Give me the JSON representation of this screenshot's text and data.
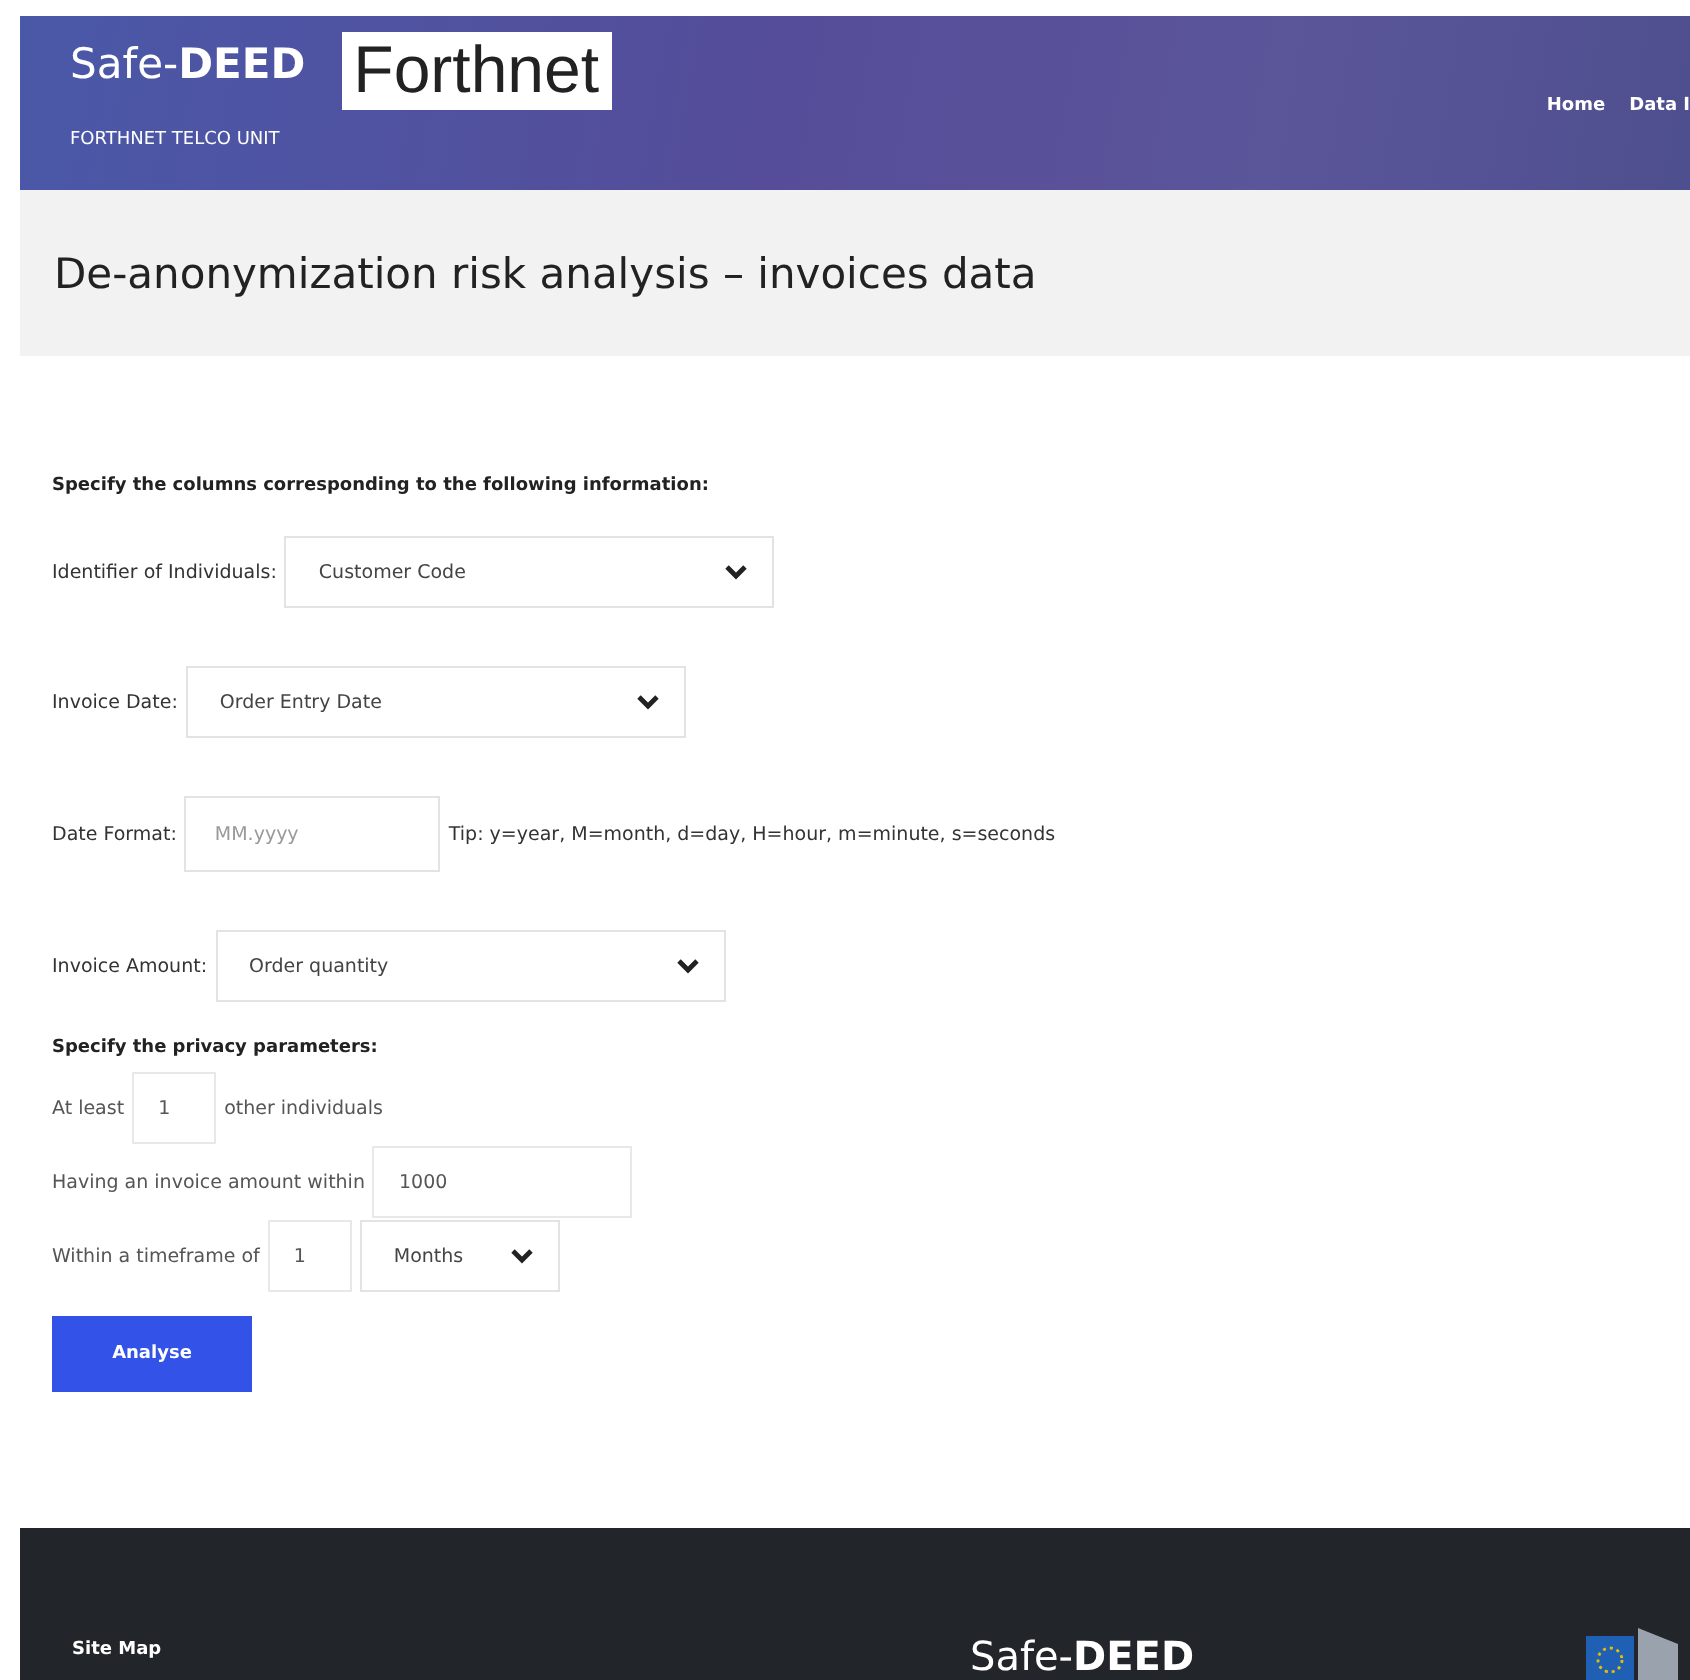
{
  "header": {
    "logo": "Safe-**DEED**",
    "brand": "Forthnet",
    "subtitle": "FORTHNET TELCO UNIT",
    "nav": [
      "Home",
      "Data I"
    ]
  },
  "page_title": "De-anonymization risk analysis – invoices data",
  "columns_heading": "Specify the columns corresponding to the following information:",
  "column_fields": [
    {
      "label": "Identifier of Individuals:",
      "kind": "select",
      "value": "Customer Code"
    },
    {
      "label": "Invoice Date:",
      "kind": "select",
      "value": "Order Entry Date"
    },
    {
      "label": "Date Format:",
      "kind": "input",
      "placeholder": "MM.yyyy",
      "tip": "Tip: y=year, M=month, d=day, H=hour, m=minute, s=seconds"
    },
    {
      "label": "Invoice Amount:",
      "kind": "select",
      "value": "Order quantity"
    }
  ],
  "privacy_heading": "Specify the privacy parameters:",
  "privacy": {
    "at_least_label": "At least",
    "at_least_value": "1",
    "at_least_suffix": "other individuals",
    "amount_label": "Having an invoice amount within",
    "amount_value": "1000",
    "timeframe_label": "Within a timeframe of",
    "timeframe_value": "1",
    "timeframe_unit": "Months"
  },
  "button": "Analyse",
  "footer": {
    "site_map": "Site Map",
    "logo": "Safe-**DEED**"
  }
}
